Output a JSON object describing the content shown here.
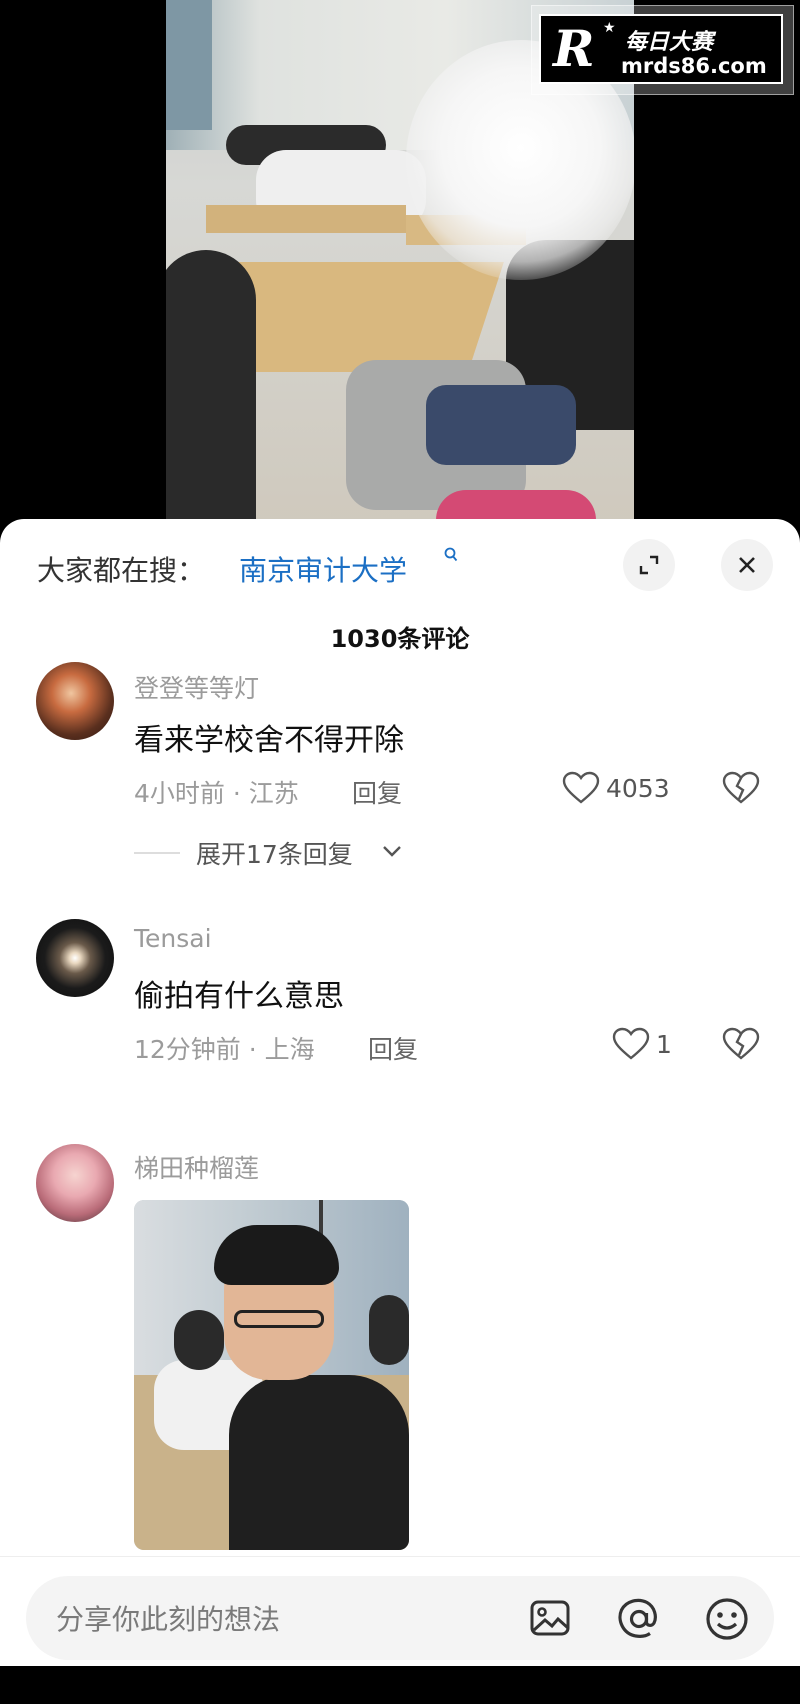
{
  "watermark": {
    "logo_letter": "R",
    "brand_cn": "每日大赛",
    "url": "mrds86.com"
  },
  "sheet": {
    "search_prefix": "大家都在搜：",
    "search_term": "南京审计大学",
    "comment_count_title": "1030条评论"
  },
  "comments": [
    {
      "username": "登登等等灯",
      "text": "看来学校舍不得开除",
      "time_location": "4小时前 · 江苏",
      "reply_label": "回复",
      "likes": "4053",
      "expand_replies": "展开17条回复"
    },
    {
      "username": "Tensai",
      "text": "偷拍有什么意思",
      "time_location": "12分钟前 · 上海",
      "reply_label": "回复",
      "likes": "1"
    },
    {
      "username": "梯田种榴莲"
    }
  ],
  "input_bar": {
    "placeholder": "分享你此刻的想法",
    "icons": [
      "image-icon",
      "at-icon",
      "emoji-icon"
    ]
  },
  "colors": {
    "link_blue": "#1b6fc4",
    "muted_gray": "#9b9b9b"
  }
}
